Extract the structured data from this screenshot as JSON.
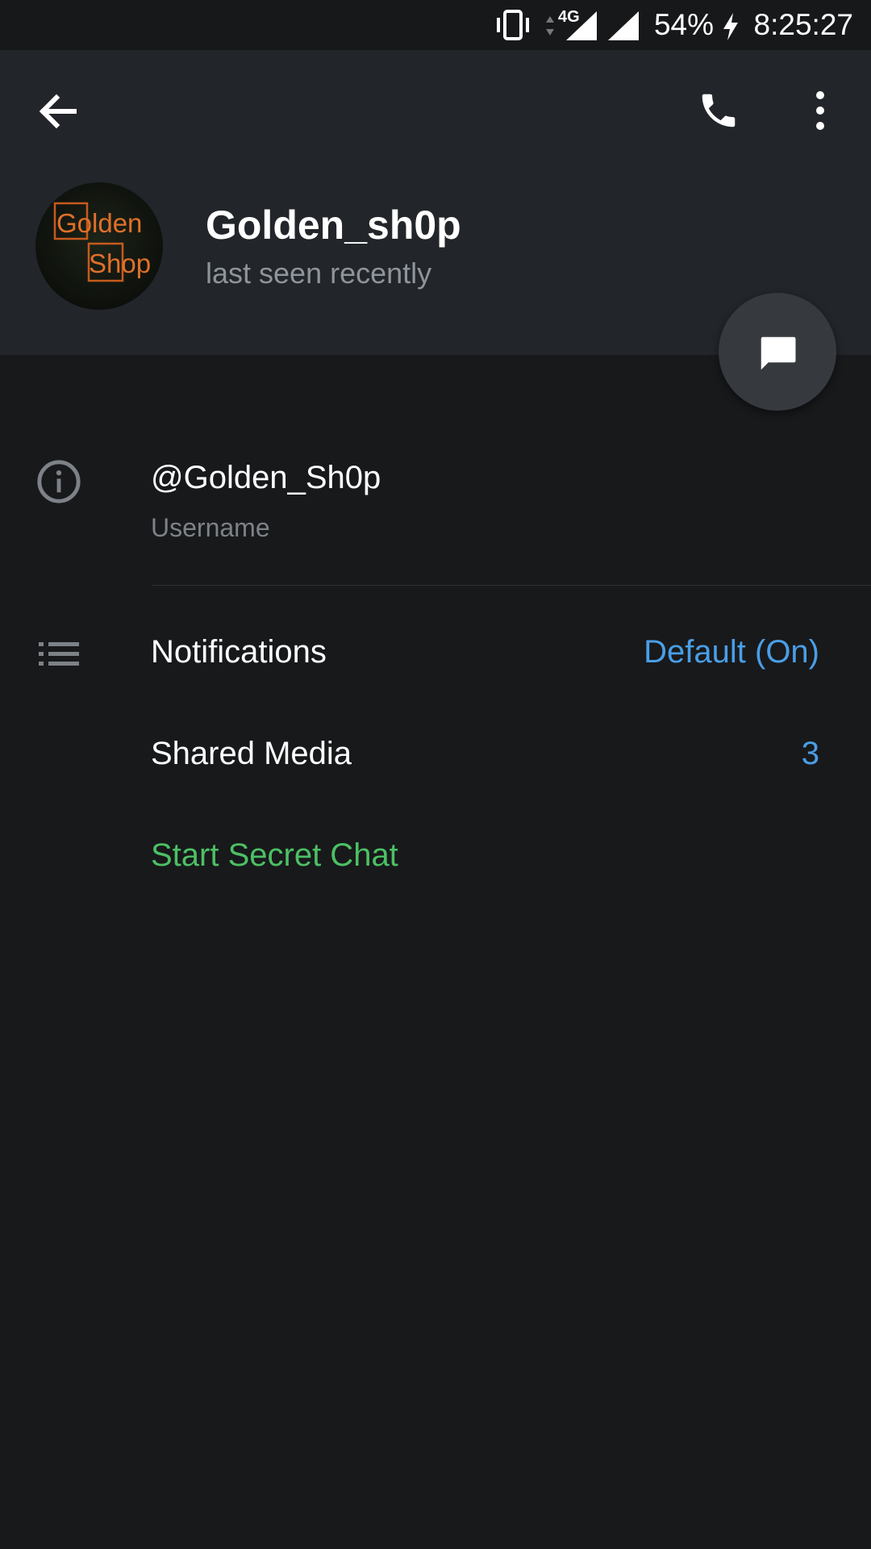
{
  "status_bar": {
    "network_type": "4G",
    "battery_percent": "54%",
    "time": "8:25:27",
    "icons": [
      "vibrate-icon",
      "data-arrows-icon",
      "signal-icon",
      "signal-icon",
      "charging-icon"
    ]
  },
  "toolbar": {
    "back_icon": "arrow-left-icon",
    "call_icon": "phone-icon",
    "menu_icon": "more-vertical-icon"
  },
  "profile": {
    "name": "Golden_sh0p",
    "status": "last seen recently",
    "avatar_text_line1": "Golden",
    "avatar_text_line2": "Shop"
  },
  "fab": {
    "icon": "message-icon"
  },
  "info": {
    "username": "@Golden_Sh0p",
    "username_label": "Username",
    "icon": "info-icon"
  },
  "settings": {
    "icon": "list-icon",
    "notifications_label": "Notifications",
    "notifications_value": "Default (On)",
    "shared_media_label": "Shared Media",
    "shared_media_value": "3",
    "secret_chat_label": "Start Secret Chat"
  },
  "colors": {
    "background": "#18191b",
    "header": "#222529",
    "accent_blue": "#4a9ee6",
    "accent_green": "#4cc064",
    "secondary_text": "#8e949b"
  }
}
